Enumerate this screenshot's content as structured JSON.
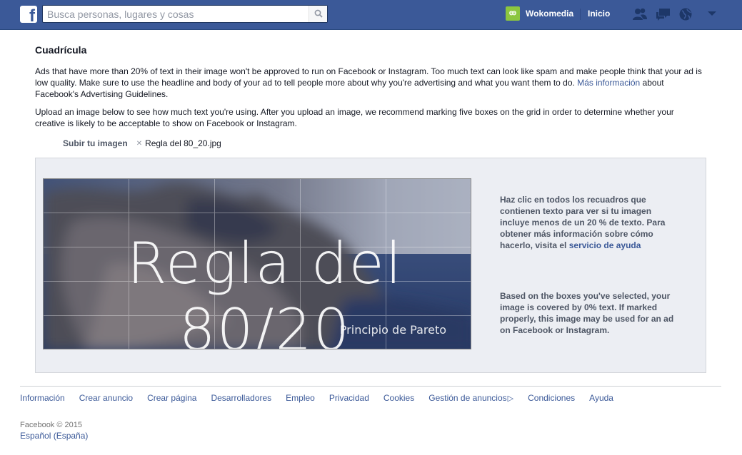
{
  "header": {
    "search_placeholder": "Busca personas, lugares y cosas",
    "profile_name": "Wokomedia",
    "home_label": "Inicio",
    "brand_color": "#3b5998"
  },
  "main": {
    "title": "Cuadrícula",
    "paragraph1_text": "Ads that have more than 20% of text in their image won't be approved to run on Facebook or Instagram. Too much text can look like spam and make people think that your ad is low quality. Make sure to use the headline and body of your ad to tell people more about why you're advertising and what you want them to do. ",
    "paragraph1_link": "Más información",
    "paragraph1_tail": " about Facebook's Advertising Guidelines.",
    "paragraph2": "Upload an image below to see how much text you're using. After you upload an image, we recommend marking five boxes on the grid in order to determine whether your creative is likely to be acceptable to show on Facebook or Instagram.",
    "upload_label": "Subir tu imagen",
    "file_name": "Regla del 80_20.jpg"
  },
  "image": {
    "title_text": "Regla del 80/20",
    "subtitle_text": "Principio de Pareto"
  },
  "sidebar": {
    "info1_text": "Haz clic en todos los recuadros que contienen texto para ver si tu imagen incluye menos de un 20 % de texto. Para obtener más información sobre cómo hacerlo, visita el ",
    "info1_link": "servicio de ayuda",
    "info2_text": "Based on the boxes you've selected, your image is covered by 0% text. If marked properly, this image may be used for an ad on Facebook or Instagram."
  },
  "footer": {
    "links": [
      "Información",
      "Crear anuncio",
      "Crear página",
      "Desarrolladores",
      "Empleo",
      "Privacidad",
      "Cookies",
      "Gestión de anuncios",
      "Condiciones",
      "Ayuda"
    ],
    "copyright": "Facebook © 2015",
    "language": "Español (España)"
  }
}
